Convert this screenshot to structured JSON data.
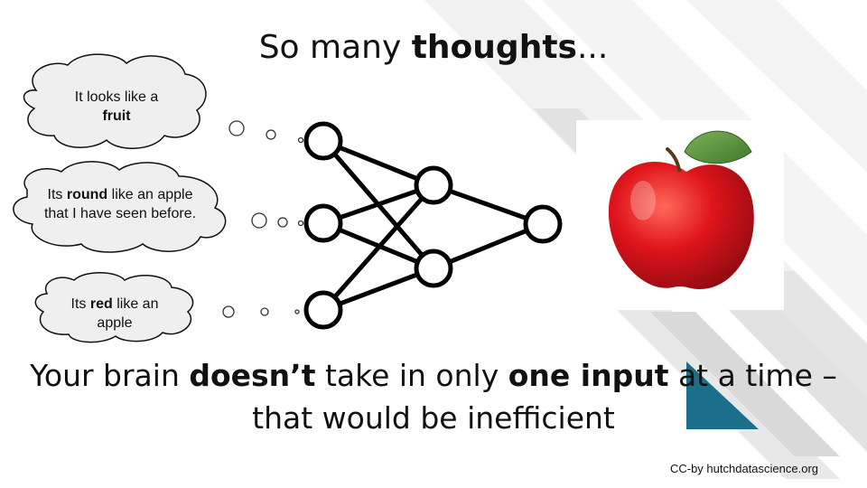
{
  "title": {
    "plain": "So many ",
    "bold": "thoughts",
    "suffix": "..."
  },
  "thoughts": [
    {
      "pre": "It looks like a ",
      "bold": "fruit",
      "post": ""
    },
    {
      "pre": "Its ",
      "bold": "round",
      "post": " like an apple that I have seen before."
    },
    {
      "pre": "Its ",
      "bold": "red",
      "post": " like an apple"
    }
  ],
  "caption": {
    "p1": "Your brain ",
    "b1": "doesn’t",
    "p2": " take in only ",
    "b2": "one input",
    "p3": " at a time – that would be inefficient"
  },
  "credit": "CC-by hutchdatascience.org",
  "image": {
    "subject": "apple"
  },
  "colors": {
    "accent_teal": "#1c6f8a",
    "stripe_gray": "#e4e4e4",
    "text": "#111111"
  }
}
